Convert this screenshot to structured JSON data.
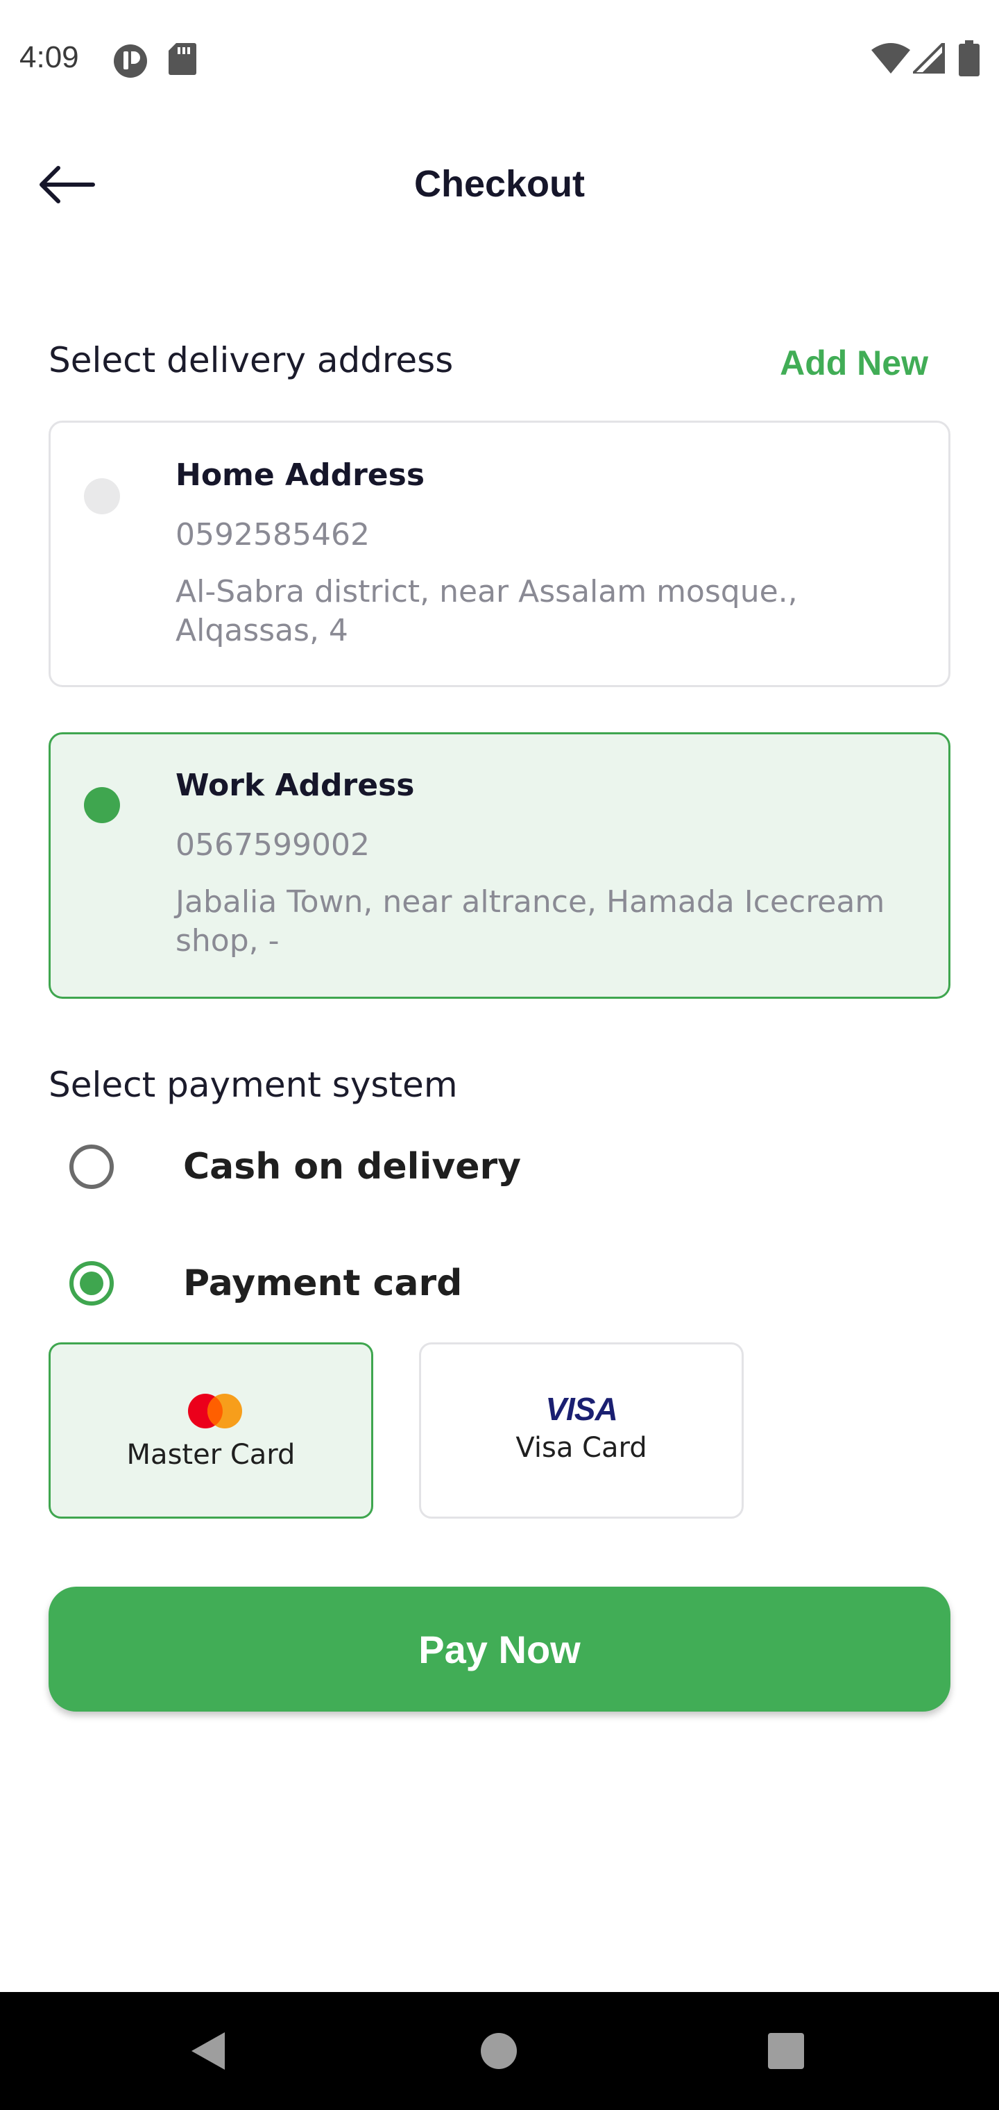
{
  "status_bar": {
    "time": "4:09"
  },
  "header": {
    "title": "Checkout"
  },
  "delivery": {
    "section_label": "Select delivery address",
    "add_new_label": "Add New",
    "addresses": [
      {
        "title": "Home Address",
        "phone": "0592585462",
        "address": "Al-Sabra district, near Assalam mosque., Alqassas, 4",
        "selected": false
      },
      {
        "title": "Work Address",
        "phone": "0567599002",
        "address": "Jabalia Town, near altrance, Hamada Icecream shop, -",
        "selected": true
      }
    ]
  },
  "payment": {
    "section_label": "Select payment system",
    "options": [
      {
        "label": "Cash on delivery",
        "selected": false
      },
      {
        "label": "Payment card",
        "selected": true
      }
    ],
    "cards": [
      {
        "label": "Master Card",
        "logo": "mastercard-logo",
        "selected": true
      },
      {
        "label": "Visa Card",
        "logo_text": "VISA",
        "selected": false
      }
    ]
  },
  "action": {
    "pay_now_label": "Pay Now"
  },
  "colors": {
    "accent": "#41ad56",
    "selected_bg": "#ebf5ed",
    "title": "#16162a",
    "muted": "#8a8a94"
  }
}
